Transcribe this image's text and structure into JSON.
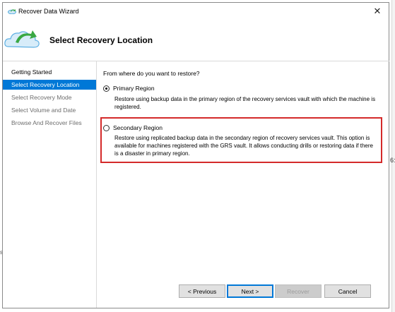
{
  "window": {
    "title": "Recover Data Wizard",
    "close_glyph": "✕"
  },
  "header": {
    "title": "Select Recovery Location",
    "icon": "cloud-restore-icon"
  },
  "steps": [
    {
      "label": "Getting Started",
      "state": "done"
    },
    {
      "label": "Select Recovery Location",
      "state": "active"
    },
    {
      "label": "Select Recovery Mode",
      "state": "future"
    },
    {
      "label": "Select Volume and Date",
      "state": "future"
    },
    {
      "label": "Browse And Recover Files",
      "state": "future"
    }
  ],
  "main": {
    "question": "From where do you want to restore?",
    "options": [
      {
        "label": "Primary Region",
        "selected": true,
        "description": "Restore using backup data in the primary region of the recovery services vault with which the machine is registered."
      },
      {
        "label": "Secondary Region",
        "selected": false,
        "description": "Restore using replicated backup data in the secondary region of recovery services vault. This option is available for machines registered with the GRS vault. It allows conducting drills or restoring data if there is a disaster in primary region."
      }
    ],
    "highlight_color": "#d42a2a"
  },
  "buttons": {
    "previous": "< Previous",
    "next": "Next >",
    "recover": "Recover",
    "cancel": "Cancel"
  },
  "background": {
    "right_text": "6:",
    "left_text": "si"
  },
  "colors": {
    "accent": "#0078d7"
  }
}
